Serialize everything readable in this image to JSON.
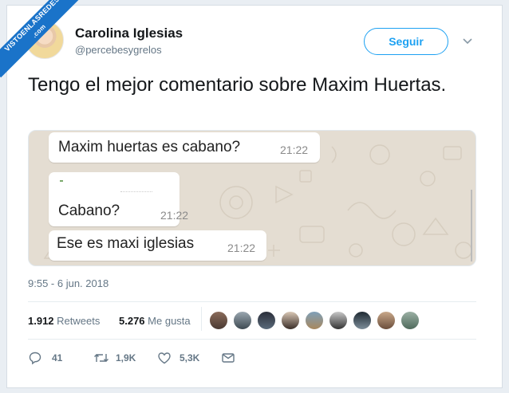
{
  "ribbon": {
    "line1": "VISTOENLASREDES",
    "line2": ".com"
  },
  "tweet": {
    "author_name": "Carolina Iglesias",
    "author_handle": "@percebesygrelos",
    "follow_label": "Seguir",
    "text": "Tengo el mejor comentario sobre Maxim Huertas.",
    "timestamp": "9:55 - 6 jun. 2018"
  },
  "chat": {
    "messages": [
      {
        "text": "Maxim huertas es cabano?",
        "time": "21:22"
      },
      {
        "text": "Cabano?",
        "time": "21:22"
      },
      {
        "text": "Ese es maxi iglesias",
        "time": "21:22"
      }
    ]
  },
  "stats": {
    "retweets_count": "1.912",
    "retweets_label": "Retweets",
    "likes_count": "5.276",
    "likes_label": "Me gusta"
  },
  "actions": {
    "reply_count": "41",
    "retweet_count": "1,9K",
    "like_count": "5,3K"
  },
  "icons": [
    "chevron-down-icon",
    "reply-icon",
    "retweet-icon",
    "heart-icon",
    "envelope-icon"
  ],
  "colors": {
    "accent": "#1da1f2",
    "muted": "#657786",
    "chat_bg": "#e4ddd2",
    "ribbon": "#1a73c9"
  }
}
